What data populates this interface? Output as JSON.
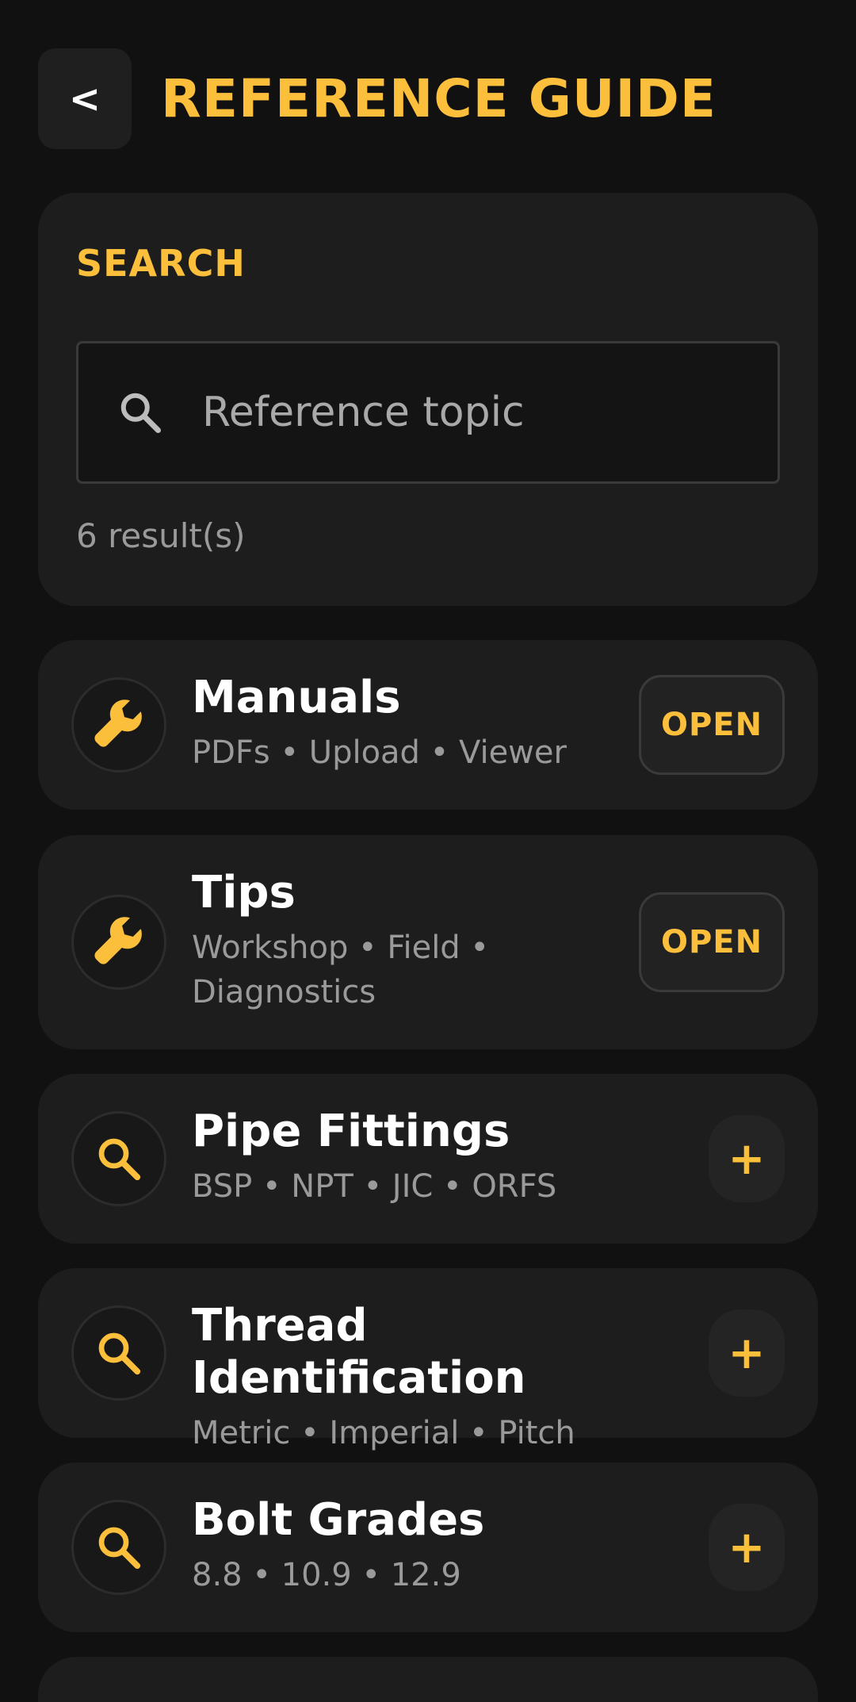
{
  "header": {
    "back_label": "<",
    "title": "REFERENCE GUIDE"
  },
  "search": {
    "label": "SEARCH",
    "placeholder": "Reference topic",
    "result_count": "6 result(s)"
  },
  "items": [
    {
      "title": "Manuals",
      "subtitle": "PDFs • Upload • Viewer",
      "icon": "wrench-icon",
      "action": "OPEN"
    },
    {
      "title": "Tips",
      "subtitle": "Workshop • Field • Diagnostics",
      "icon": "wrench-icon",
      "action": "OPEN"
    },
    {
      "title": "Pipe Fittings",
      "subtitle": "BSP • NPT • JIC • ORFS",
      "icon": "search-icon",
      "action": "+"
    },
    {
      "title": "Thread Identification",
      "subtitle": "Metric • Imperial • Pitch",
      "icon": "search-icon",
      "action": "+"
    },
    {
      "title": "Bolt Grades",
      "subtitle": "8.8 • 10.9 • 12.9",
      "icon": "search-icon",
      "action": "+"
    }
  ],
  "colors": {
    "accent": "#fbbf3b",
    "background": "#111111",
    "card": "#1d1d1d",
    "muted_text": "#9a9a9a"
  }
}
